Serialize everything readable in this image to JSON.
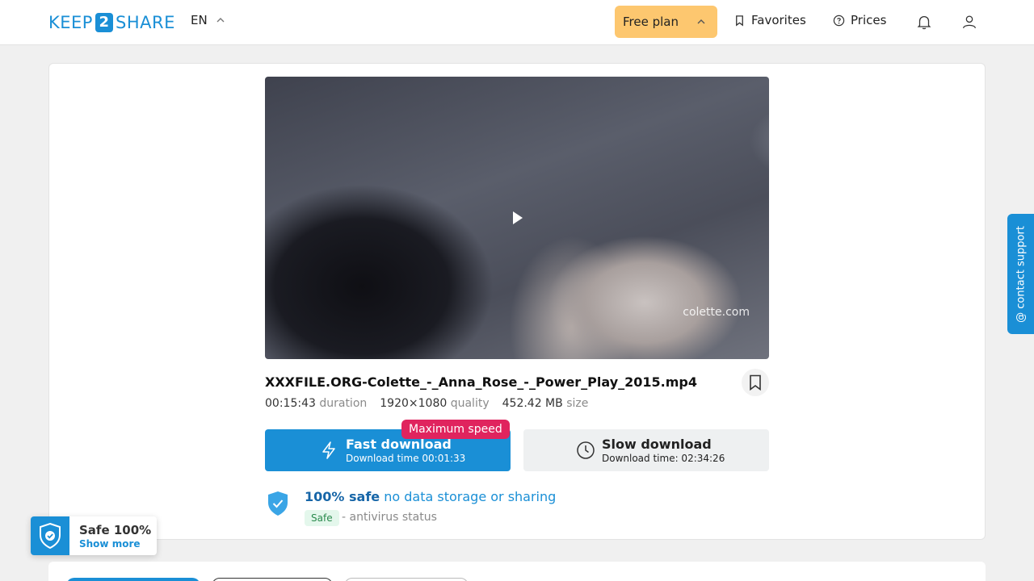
{
  "header": {
    "logo_left": "KEEP",
    "logo_mid": "2",
    "logo_right": "SHARE",
    "language": "EN",
    "plan_label": "Free plan",
    "favorites_label": "Favorites",
    "prices_label": "Prices"
  },
  "video": {
    "watermark": "colette.com"
  },
  "file": {
    "name": "XXXFILE.ORG-Colette_-_Anna_Rose_-_Power_Play_2015.mp4",
    "duration_value": "00:15:43",
    "duration_label": "duration",
    "quality_value": "1920×1080",
    "quality_label": "quality",
    "size_value": "452.42 MB",
    "size_label": "size"
  },
  "download": {
    "fast_title": "Fast download",
    "fast_time": "Download time 00:01:33",
    "max_speed_badge": "Maximum speed",
    "slow_title": "Slow download",
    "slow_time": "Download time: 02:34:26"
  },
  "safety": {
    "safe_bold": "100% safe",
    "safe_rest": "no data storage or sharing",
    "badge": "Safe",
    "antivirus": "- antivirus status"
  },
  "contact_support": "@ contact support",
  "safe_widget": {
    "title": "Safe 100%",
    "link": "Show more"
  },
  "colors": {
    "accent": "#1a8fd6",
    "plan_bg": "#fdc76f",
    "badge_red": "#e0245e"
  }
}
